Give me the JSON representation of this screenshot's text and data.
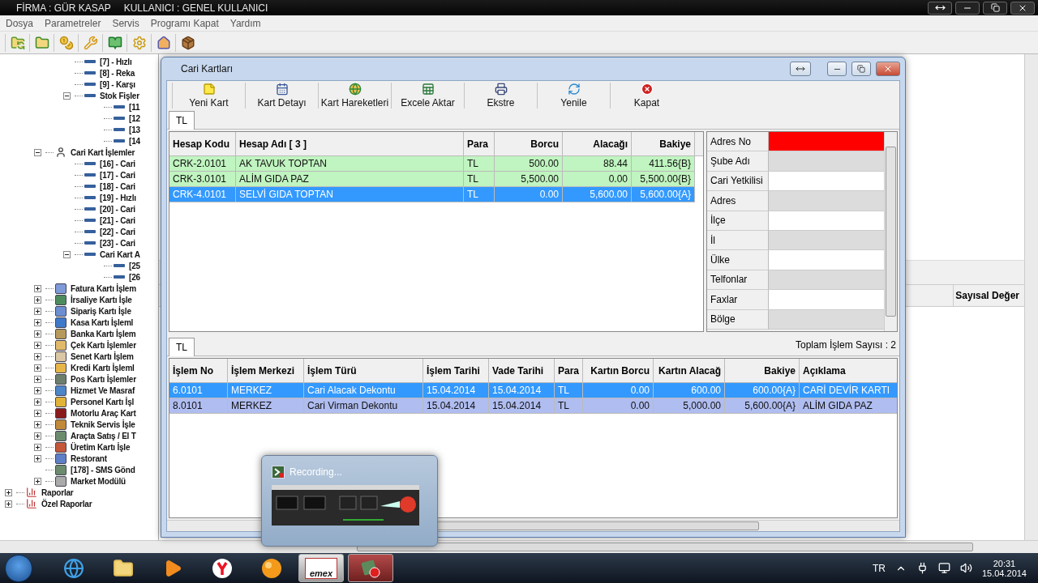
{
  "window": {
    "title_parts": [
      "FİRMA : GÜR KASAP",
      "KULLANICI : GENEL KULLANICI"
    ]
  },
  "menu": [
    "Dosya",
    "Parametreler",
    "Servis",
    "Programı Kapat",
    "Yardım"
  ],
  "tree": [
    {
      "children": [
        {
          "children": [
            {
              "label": "[7] - Hızlı"
            },
            {
              "label": "[8] - Reka"
            },
            {
              "label": "[9] - Karşı"
            },
            {
              "label": "Stok Fişler",
              "expanded": true,
              "children": [
                {
                  "label": "[11"
                },
                {
                  "label": "[12"
                },
                {
                  "label": "[13"
                },
                {
                  "label": "[14"
                }
              ]
            }
          ]
        },
        {
          "label": "Cari Kart İşlemler",
          "expanded": true,
          "children": [
            {
              "label": "[16] - Cari"
            },
            {
              "label": "[17] - Cari"
            },
            {
              "label": "[18] - Cari"
            },
            {
              "label": "[19] - Hızlı"
            },
            {
              "label": "[20] - Cari"
            },
            {
              "label": "[21] - Cari"
            },
            {
              "label": "[22] - Cari"
            },
            {
              "label": "[23] - Cari"
            },
            {
              "label": "Cari Kart A",
              "expanded": true,
              "children": [
                {
                  "label": "[25"
                },
                {
                  "label": "[26"
                }
              ]
            }
          ]
        },
        {
          "label": "Fatura Kartı İşlem",
          "expanded": false
        },
        {
          "label": "İrsaliye Kartı İşle",
          "expanded": false
        },
        {
          "label": "Sipariş Kartı İşle",
          "expanded": false
        },
        {
          "label": "Kasa Kartı İşleml",
          "expanded": false
        },
        {
          "label": "Banka Kartı İşlem",
          "expanded": false
        },
        {
          "label": "Çek Kartı İşlemler",
          "expanded": false
        },
        {
          "label": "Senet Kartı İşlem",
          "expanded": false
        },
        {
          "label": "Kredi Kartı İşleml",
          "expanded": false
        },
        {
          "label": "Pos Kartı İşlemler",
          "expanded": false
        },
        {
          "label": "Hizmet Ve Masraf",
          "expanded": false
        },
        {
          "label": "Personel Kartı İşl",
          "expanded": false
        },
        {
          "label": "Motorlu Araç Kart",
          "expanded": false
        },
        {
          "label": "Teknik Servis İşle",
          "expanded": false
        },
        {
          "label": "Araçta Satış / El T",
          "expanded": false
        },
        {
          "label": "Üretim Kartı İşle",
          "expanded": false
        },
        {
          "label": "Restorant",
          "expanded": false
        },
        {
          "label": "[178] - SMS Gönd"
        },
        {
          "label": "Market Modülü",
          "expanded": false
        }
      ]
    },
    {
      "label": "Raporlar",
      "expanded": false
    },
    {
      "label": "Özel Raporlar",
      "expanded": false
    }
  ],
  "background_grid": {
    "columns": [
      "Sayısal Değer"
    ]
  },
  "dialog": {
    "title": "Cari Kartları",
    "toolbar": [
      "Yeni Kart",
      "Kart Detayı",
      "Kart Hareketleri",
      "Excele Aktar",
      "Ekstre",
      "Yenile",
      "Kapat"
    ],
    "tabs": [
      {
        "label": "TL",
        "selected": true
      }
    ],
    "accounts": {
      "columns": [
        {
          "label": "Hesap Kodu",
          "numeric": false
        },
        {
          "label": "Hesap Adı  [ 3 ]",
          "numeric": false
        },
        {
          "label": "Para",
          "numeric": false
        },
        {
          "label": "Borcu",
          "numeric": true
        },
        {
          "label": "Alacağı",
          "numeric": true
        },
        {
          "label": "Bakiye",
          "numeric": true
        }
      ],
      "rows": [
        {
          "selected": false,
          "cells": [
            "CRK-2.0101",
            "AK TAVUK TOPTAN",
            "TL",
            "500.00",
            "88.44",
            "411.56{B}"
          ]
        },
        {
          "selected": false,
          "cells": [
            "CRK-3.0101",
            "ALİM GIDA PAZ",
            "TL",
            "5,500.00",
            "0.00",
            "5,500.00{B}"
          ]
        },
        {
          "selected": true,
          "cells": [
            "CRK-4.0101",
            "SELVİ GIDA TOPTAN",
            "TL",
            "0.00",
            "5,600.00",
            "5,600.00{A}"
          ]
        }
      ]
    },
    "details": [
      {
        "label": "Adres No",
        "selected": true
      },
      {
        "label": "Şube Adı",
        "selected": false
      },
      {
        "label": "Cari Yetkilisi",
        "selected": false
      },
      {
        "label": "Adres",
        "selected": false
      },
      {
        "label": "İlçe",
        "selected": false
      },
      {
        "label": "İl",
        "selected": false
      },
      {
        "label": "Ülke",
        "selected": false
      },
      {
        "label": "Telfonlar",
        "selected": false
      },
      {
        "label": "Faxlar",
        "selected": false
      },
      {
        "label": "Bölge",
        "selected": false
      }
    ],
    "movements": {
      "tabs": [
        {
          "label": "TL",
          "selected": true
        }
      ],
      "total": "Toplam İşlem Sayısı : 2",
      "columns": [
        {
          "label": "İşlem No",
          "numeric": false
        },
        {
          "label": "İşlem Merkezi",
          "numeric": false
        },
        {
          "label": "İşlem Türü",
          "numeric": false
        },
        {
          "label": "İşlem Tarihi",
          "numeric": false
        },
        {
          "label": "Vade Tarihi",
          "numeric": false
        },
        {
          "label": "Para",
          "numeric": false
        },
        {
          "label": "Kartın Borcu",
          "numeric": true
        },
        {
          "label": "Kartın Alacağ",
          "numeric": true
        },
        {
          "label": "Bakiye",
          "numeric": true
        },
        {
          "label": "Açıklama",
          "numeric": false
        }
      ],
      "rows": [
        {
          "selected": true,
          "cells": [
            "6.0101",
            "MERKEZ",
            "Cari Alacak Dekontu",
            "15.04.2014",
            "15.04.2014",
            "TL",
            "0.00",
            "600.00",
            "600.00{A}",
            "CARİ DEVİR KARTI"
          ]
        },
        {
          "selected": false,
          "cells": [
            "8.0101",
            "MERKEZ",
            "Cari Virman Dekontu",
            "15.04.2014",
            "15.04.2014",
            "TL",
            "0.00",
            "5,000.00",
            "5,600.00{A}",
            "ALİM GIDA PAZ"
          ]
        }
      ]
    }
  },
  "recording": {
    "title": "Recording..."
  },
  "taskbar": {
    "items": [
      {
        "kind": "ie",
        "running": false
      },
      {
        "kind": "folder",
        "running": false
      },
      {
        "kind": "media",
        "running": false
      },
      {
        "kind": "yandex",
        "running": false
      },
      {
        "kind": "ball",
        "running": false
      },
      {
        "kind": "emex",
        "label": "emex",
        "running": true
      },
      {
        "kind": "recorder",
        "running": true
      }
    ],
    "language": "TR",
    "time": "20:31",
    "date": "15.04.2014"
  }
}
